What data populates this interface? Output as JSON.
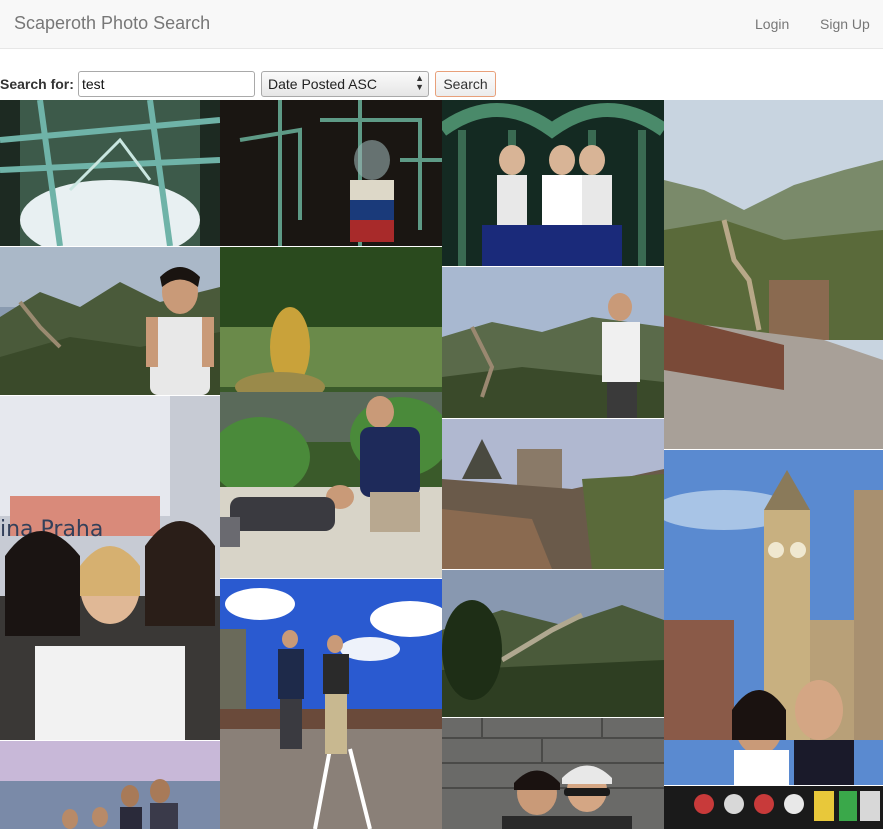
{
  "navbar": {
    "brand": "Scaperoth Photo Search",
    "login": "Login",
    "signup": "Sign Up"
  },
  "search": {
    "label": "Search for:",
    "query": "test",
    "sort_selected": "Date Posted ASC",
    "button": "Search"
  },
  "photos": [
    {
      "subject": "glass-sculpture"
    },
    {
      "subject": "glass-apparatus"
    },
    {
      "subject": "mirror-room-people"
    },
    {
      "subject": "great-wall-landscape"
    },
    {
      "subject": "woman-great-wall"
    },
    {
      "subject": "fountain-statue-people"
    },
    {
      "subject": "man-great-wall"
    },
    {
      "subject": "great-wall-tower"
    },
    {
      "subject": "three-friends-selfie"
    },
    {
      "subject": "crowd-square"
    },
    {
      "subject": "great-wall-hills"
    },
    {
      "subject": "big-ben-couple"
    },
    {
      "subject": "group-hikers"
    },
    {
      "subject": "couple-selfie-wall"
    },
    {
      "subject": "shop-shelf"
    }
  ]
}
